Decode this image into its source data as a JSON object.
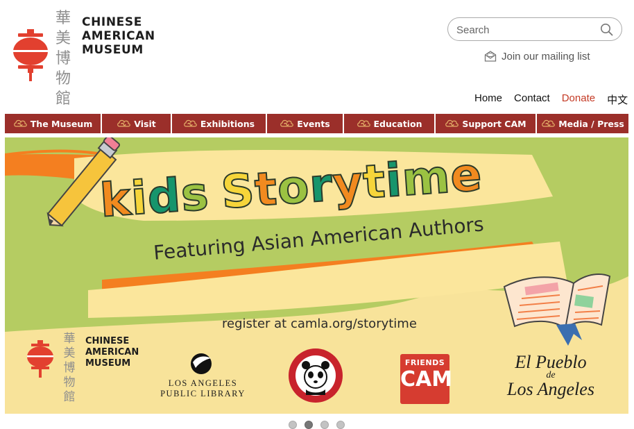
{
  "logo": {
    "chinese_chars": [
      "華",
      "美",
      "博",
      "物",
      "館"
    ],
    "english_lines": [
      "CHINESE",
      "AMERICAN",
      "MUSEUM"
    ]
  },
  "search": {
    "placeholder": "Search",
    "icon": "search-icon"
  },
  "mailing": {
    "label": "Join our mailing list",
    "icon": "envelope-icon"
  },
  "top_nav": [
    {
      "label": "Home"
    },
    {
      "label": "Contact"
    },
    {
      "label": "Donate"
    },
    {
      "label": "中文"
    }
  ],
  "main_nav": [
    {
      "label": "The Museum",
      "icon": "cloud-ornament-icon"
    },
    {
      "label": "Visit",
      "icon": "cloud-ornament-icon"
    },
    {
      "label": "Exhibitions",
      "icon": "cloud-ornament-icon"
    },
    {
      "label": "Events",
      "icon": "cloud-ornament-icon"
    },
    {
      "label": "Education",
      "icon": "cloud-ornament-icon"
    },
    {
      "label": "Support CAM",
      "icon": "cloud-ornament-icon"
    },
    {
      "label": "Media / Press",
      "icon": "cloud-ornament-icon"
    }
  ],
  "banner": {
    "title_letters": [
      "k",
      "i",
      "d",
      "s",
      " ",
      "S",
      "t",
      "o",
      "r",
      "y",
      "t",
      "i",
      "m",
      "e"
    ],
    "subtitle": "Featuring Asian American Authors",
    "register": "register at camla.org/storytime",
    "cam_chinese": [
      "華",
      "美",
      "博",
      "物",
      "館"
    ],
    "cam_english": [
      "CHINESE",
      "AMERICAN",
      "MUSEUM"
    ],
    "lapl": [
      "LOS ANGELES",
      "PUBLIC LIBRARY"
    ],
    "panda_top": "PANDA EXPRESS",
    "panda_bottom": "CHINESE KITCHEN",
    "friends_top": "FRIENDS",
    "friends_main": "CAM",
    "pueblo": [
      "El Pueblo",
      "de",
      "Los Angeles"
    ]
  },
  "carousel": {
    "dot_count": 4,
    "active_index": 1
  },
  "colors": {
    "nav_bg": "#9b2f2a",
    "donate": "#c43a25",
    "lantern": "#e2402f",
    "title_palette": [
      "#f18a1f",
      "#f6d53a",
      "#16956c",
      "#9bc242"
    ]
  }
}
